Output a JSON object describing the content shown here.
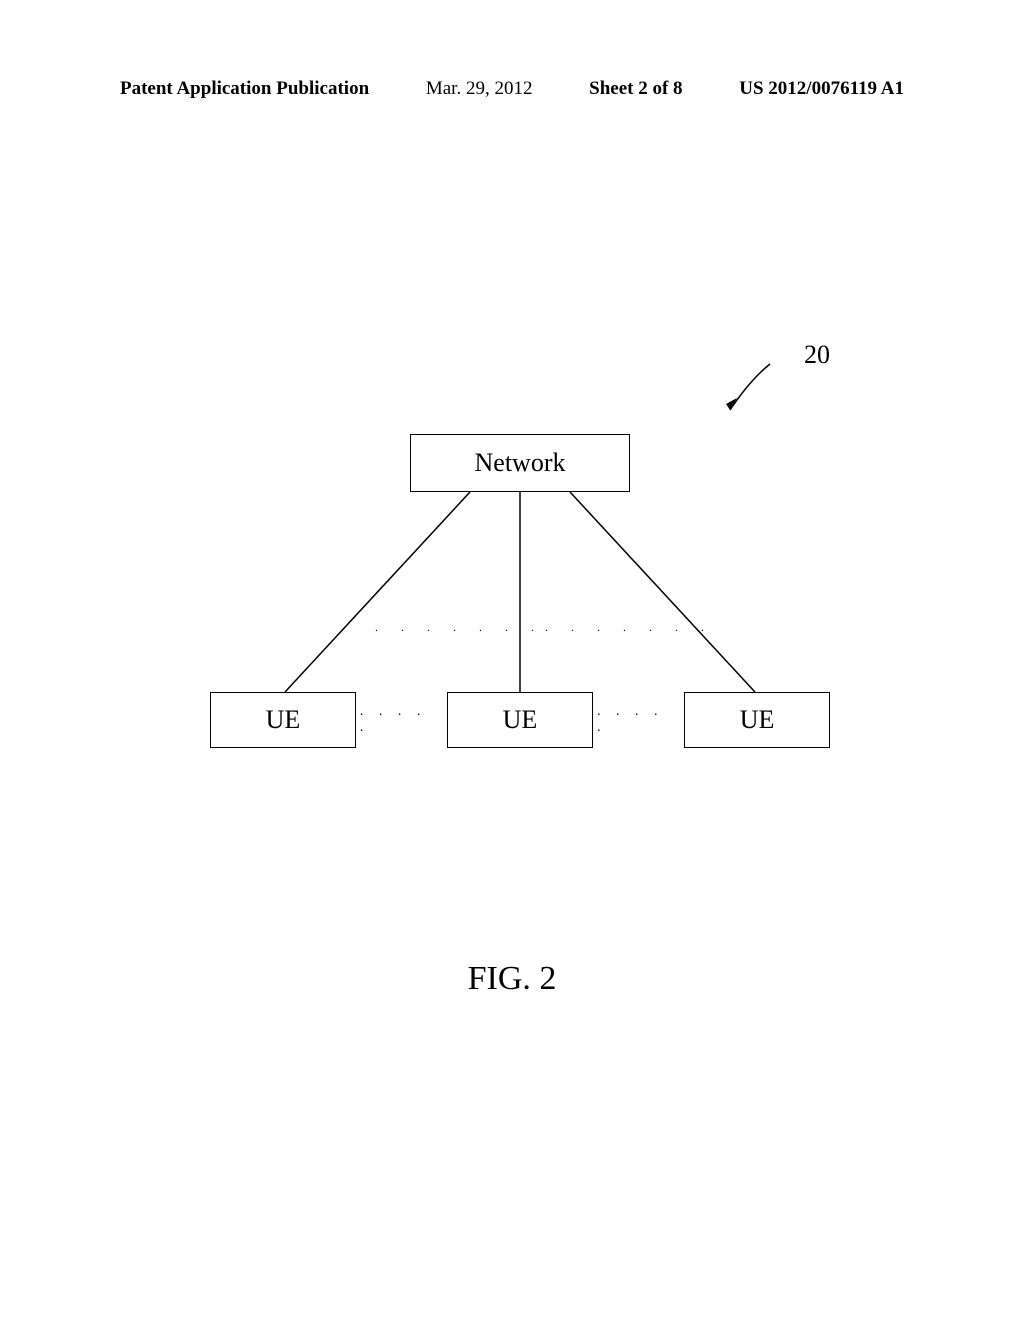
{
  "header": {
    "pub_type": "Patent Application Publication",
    "date": "Mar. 29, 2012",
    "sheet": "Sheet 2 of 8",
    "pub_num": "US 2012/0076119 A1"
  },
  "diagram": {
    "ref_num": "20",
    "network_label": "Network",
    "ue_label_1": "UE",
    "ue_label_2": "UE",
    "ue_label_3": "UE",
    "dots_small_1": ". . . . .",
    "dots_small_2": ". . . . .",
    "dots_upper_1": ". . . . . . .",
    "dots_upper_2": ". . . . . . ."
  },
  "figure_label": "FIG. 2"
}
